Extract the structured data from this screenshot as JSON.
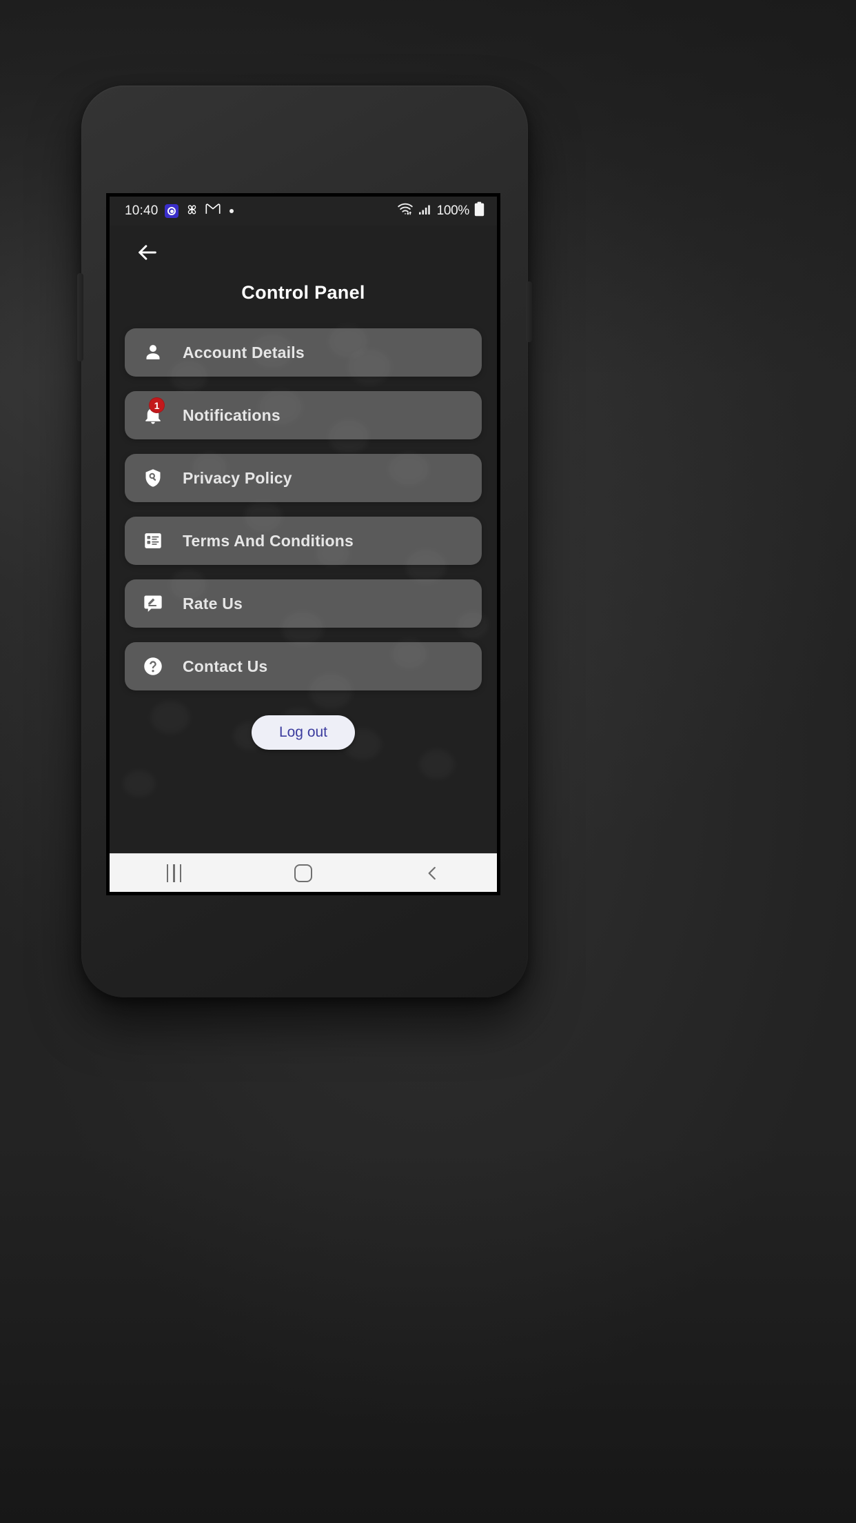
{
  "status_bar": {
    "time": "10:40",
    "left_icons": [
      "alarm-app-icon",
      "pinwheel-app-icon",
      "gmail-app-icon",
      "more-dot-icon"
    ],
    "wifi_icon": "wifi-icon",
    "signal_icon": "cellular-signal-icon",
    "battery_percent": "100%",
    "battery_icon": "battery-full-icon"
  },
  "header": {
    "back_icon": "back-arrow-icon",
    "title": "Control Panel"
  },
  "menu": {
    "items": [
      {
        "label": "Account Details",
        "icon": "person-icon",
        "badge": ""
      },
      {
        "label": "Notifications",
        "icon": "bell-icon",
        "badge": "1"
      },
      {
        "label": "Privacy Policy",
        "icon": "shield-search-icon",
        "badge": ""
      },
      {
        "label": "Terms And Conditions",
        "icon": "list-document-icon",
        "badge": ""
      },
      {
        "label": "Rate Us",
        "icon": "rate-review-icon",
        "badge": ""
      },
      {
        "label": "Contact Us",
        "icon": "help-question-icon",
        "badge": ""
      }
    ]
  },
  "logout": {
    "label": "Log out"
  },
  "nav_bar": {
    "recents_icon": "recents-icon",
    "home_icon": "home-icon",
    "back_icon": "nav-back-chevron-icon"
  },
  "colors": {
    "screen_bg": "#212121",
    "card_bg": "rgba(255,255,255,0.26)",
    "badge_red": "#c3191c",
    "logout_bg": "#eeeff7",
    "logout_text": "#3b3b9e",
    "navbar_bg": "#f4f4f4"
  }
}
